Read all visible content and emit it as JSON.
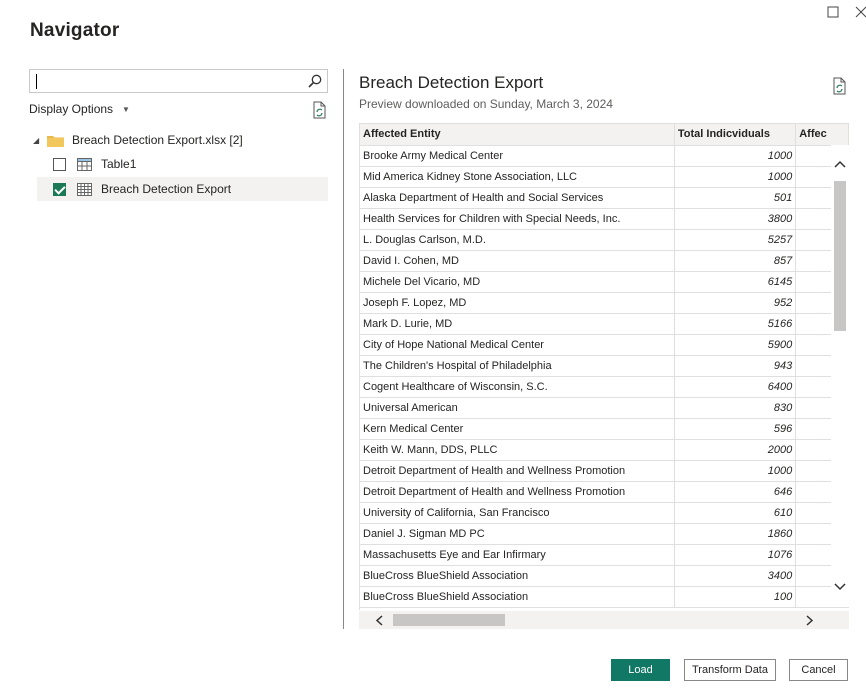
{
  "window": {
    "maximize_icon": "square-outline",
    "close_icon": "x"
  },
  "title": "Navigator",
  "search": {
    "value": "",
    "placeholder": ""
  },
  "display_options": {
    "label": "Display Options"
  },
  "tree": {
    "root": {
      "label": "Breach Detection Export.xlsx [2]",
      "expanded": true
    },
    "items": [
      {
        "label": "Table1",
        "checked": false,
        "selected": false
      },
      {
        "label": "Breach Detection Export",
        "checked": true,
        "selected": true
      }
    ]
  },
  "preview": {
    "title": "Breach Detection Export",
    "subtitle": "Preview downloaded on Sunday, March 3, 2024",
    "columns": [
      "Affected Entity",
      "Total Indicviduals",
      "Affec"
    ],
    "rows": [
      [
        "Brooke Army Medical Center",
        "1000"
      ],
      [
        "Mid America Kidney Stone Association, LLC",
        "1000"
      ],
      [
        "Alaska Department of Health and Social Services",
        "501"
      ],
      [
        "Health Services for Children with Special Needs, Inc.",
        "3800"
      ],
      [
        "L. Douglas Carlson, M.D.",
        "5257"
      ],
      [
        "David I. Cohen, MD",
        "857"
      ],
      [
        "Michele Del Vicario, MD",
        "6145"
      ],
      [
        "Joseph F. Lopez, MD",
        "952"
      ],
      [
        "Mark D. Lurie, MD",
        "5166"
      ],
      [
        "City of Hope National Medical Center",
        "5900"
      ],
      [
        "The Children's Hospital of Philadelphia",
        "943"
      ],
      [
        "Cogent Healthcare of Wisconsin, S.C.",
        "6400"
      ],
      [
        "Universal American",
        "830"
      ],
      [
        "Kern Medical Center",
        "596"
      ],
      [
        "Keith W. Mann, DDS, PLLC",
        "2000"
      ],
      [
        "Detroit Department of Health and Wellness Promotion",
        "1000"
      ],
      [
        "Detroit Department of Health and Wellness Promotion",
        "646"
      ],
      [
        "University of California, San Francisco",
        "610"
      ],
      [
        "Daniel J. Sigman MD PC",
        "1860"
      ],
      [
        "Massachusetts Eye and Ear Infirmary",
        "1076"
      ],
      [
        "BlueCross BlueShield Association",
        "3400"
      ],
      [
        "BlueCross BlueShield Association",
        "100"
      ]
    ]
  },
  "buttons": {
    "load": "Load",
    "transform": "Transform Data",
    "cancel": "Cancel"
  },
  "colors": {
    "primary": "#117865",
    "checkbox": "#1b7a55",
    "folder": "#e8b84a"
  }
}
